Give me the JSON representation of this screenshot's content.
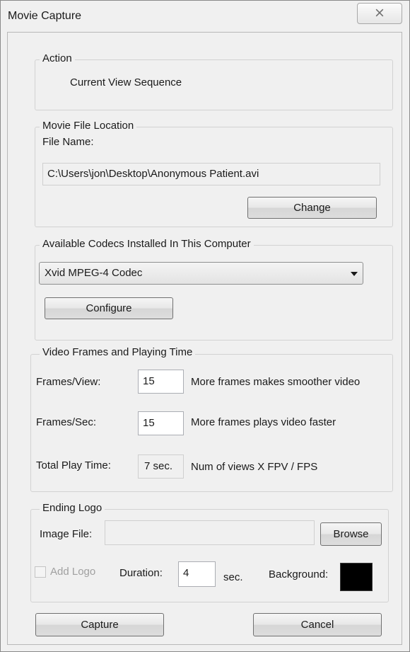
{
  "window": {
    "title": "Movie Capture",
    "close_glyph": "⨯"
  },
  "action": {
    "legend": "Action",
    "value": "Current View Sequence"
  },
  "file_location": {
    "legend": "Movie File Location",
    "file_name_label": "File Name:",
    "path": "C:\\Users\\jon\\Desktop\\Anonymous Patient.avi",
    "change_label": "Change"
  },
  "codecs": {
    "legend": "Available Codecs Installed In This Computer",
    "selected": "Xvid MPEG-4 Codec",
    "configure_label": "Configure"
  },
  "video": {
    "legend": "Video Frames and Playing Time",
    "frames_view_label": "Frames/View:",
    "frames_view_value": "15",
    "frames_view_hint": "More frames makes smoother video",
    "frames_sec_label": "Frames/Sec:",
    "frames_sec_value": "15",
    "frames_sec_hint": "More frames plays video faster",
    "total_label": "Total Play Time:",
    "total_value": "7 sec.",
    "total_hint": "Num of views X FPV / FPS"
  },
  "logo": {
    "legend": "Ending Logo",
    "image_file_label": "Image File:",
    "image_file_value": "",
    "browse_label": "Browse",
    "add_logo_label": "Add Logo",
    "add_logo_checked": false,
    "duration_label": "Duration:",
    "duration_value": "4",
    "duration_unit": "sec.",
    "background_label": "Background:",
    "background_color": "#000000"
  },
  "footer": {
    "capture_label": "Capture",
    "cancel_label": "Cancel"
  }
}
